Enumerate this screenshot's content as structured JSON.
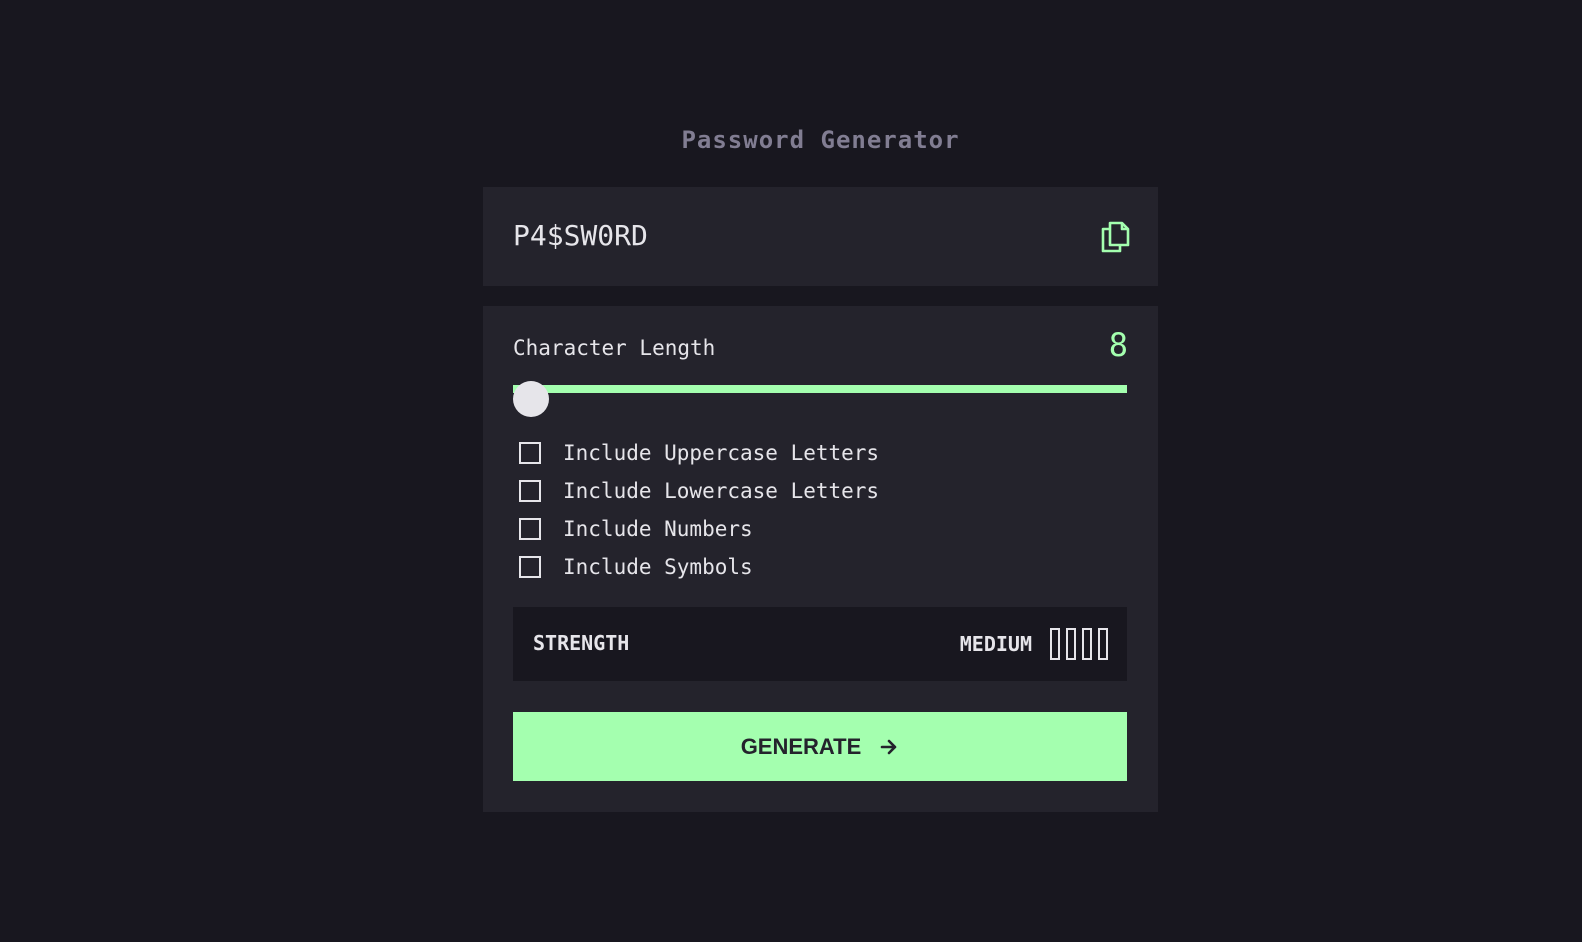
{
  "app": {
    "title": "Password Generator"
  },
  "output": {
    "password": "P4$SW0RD",
    "copy_icon": "copy-icon"
  },
  "length": {
    "label": "Character Length",
    "value": "8",
    "slider_fraction": 0.03
  },
  "options": [
    {
      "label": "Include Uppercase Letters",
      "checked": false
    },
    {
      "label": "Include Lowercase Letters",
      "checked": false
    },
    {
      "label": "Include Numbers",
      "checked": false
    },
    {
      "label": "Include Symbols",
      "checked": false
    }
  ],
  "strength": {
    "label": "STRENGTH",
    "level": "MEDIUM",
    "bars_filled": 0,
    "bars_total": 4
  },
  "generate": {
    "label": "GENERATE",
    "icon": "arrow-right-icon"
  },
  "colors": {
    "background": "#18171f",
    "panel": "#24232c",
    "accent": "#a4ffaf",
    "text": "#e6e5ea",
    "muted": "#817d92"
  }
}
